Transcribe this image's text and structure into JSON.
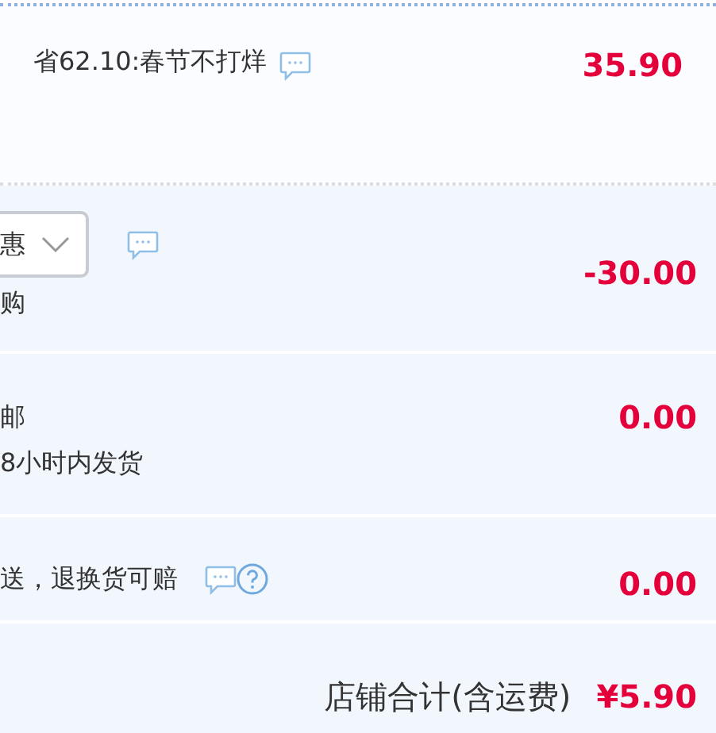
{
  "rows": [
    {
      "kind": "promo",
      "label": "省62.10:春节不打烊",
      "chat": true,
      "price": "35.90"
    },
    {
      "kind": "discount",
      "select_value": "惠",
      "note": "购",
      "chat": true,
      "price": "-30.00"
    },
    {
      "kind": "shipping",
      "label": "邮",
      "note": "8小时内发货",
      "price": "0.00"
    },
    {
      "kind": "insurance",
      "label": "送，退换货可赔",
      "chat": true,
      "help": true,
      "price": "0.00"
    }
  ],
  "total": {
    "label": "店铺合计(含运费)",
    "amount": "¥5.90"
  }
}
